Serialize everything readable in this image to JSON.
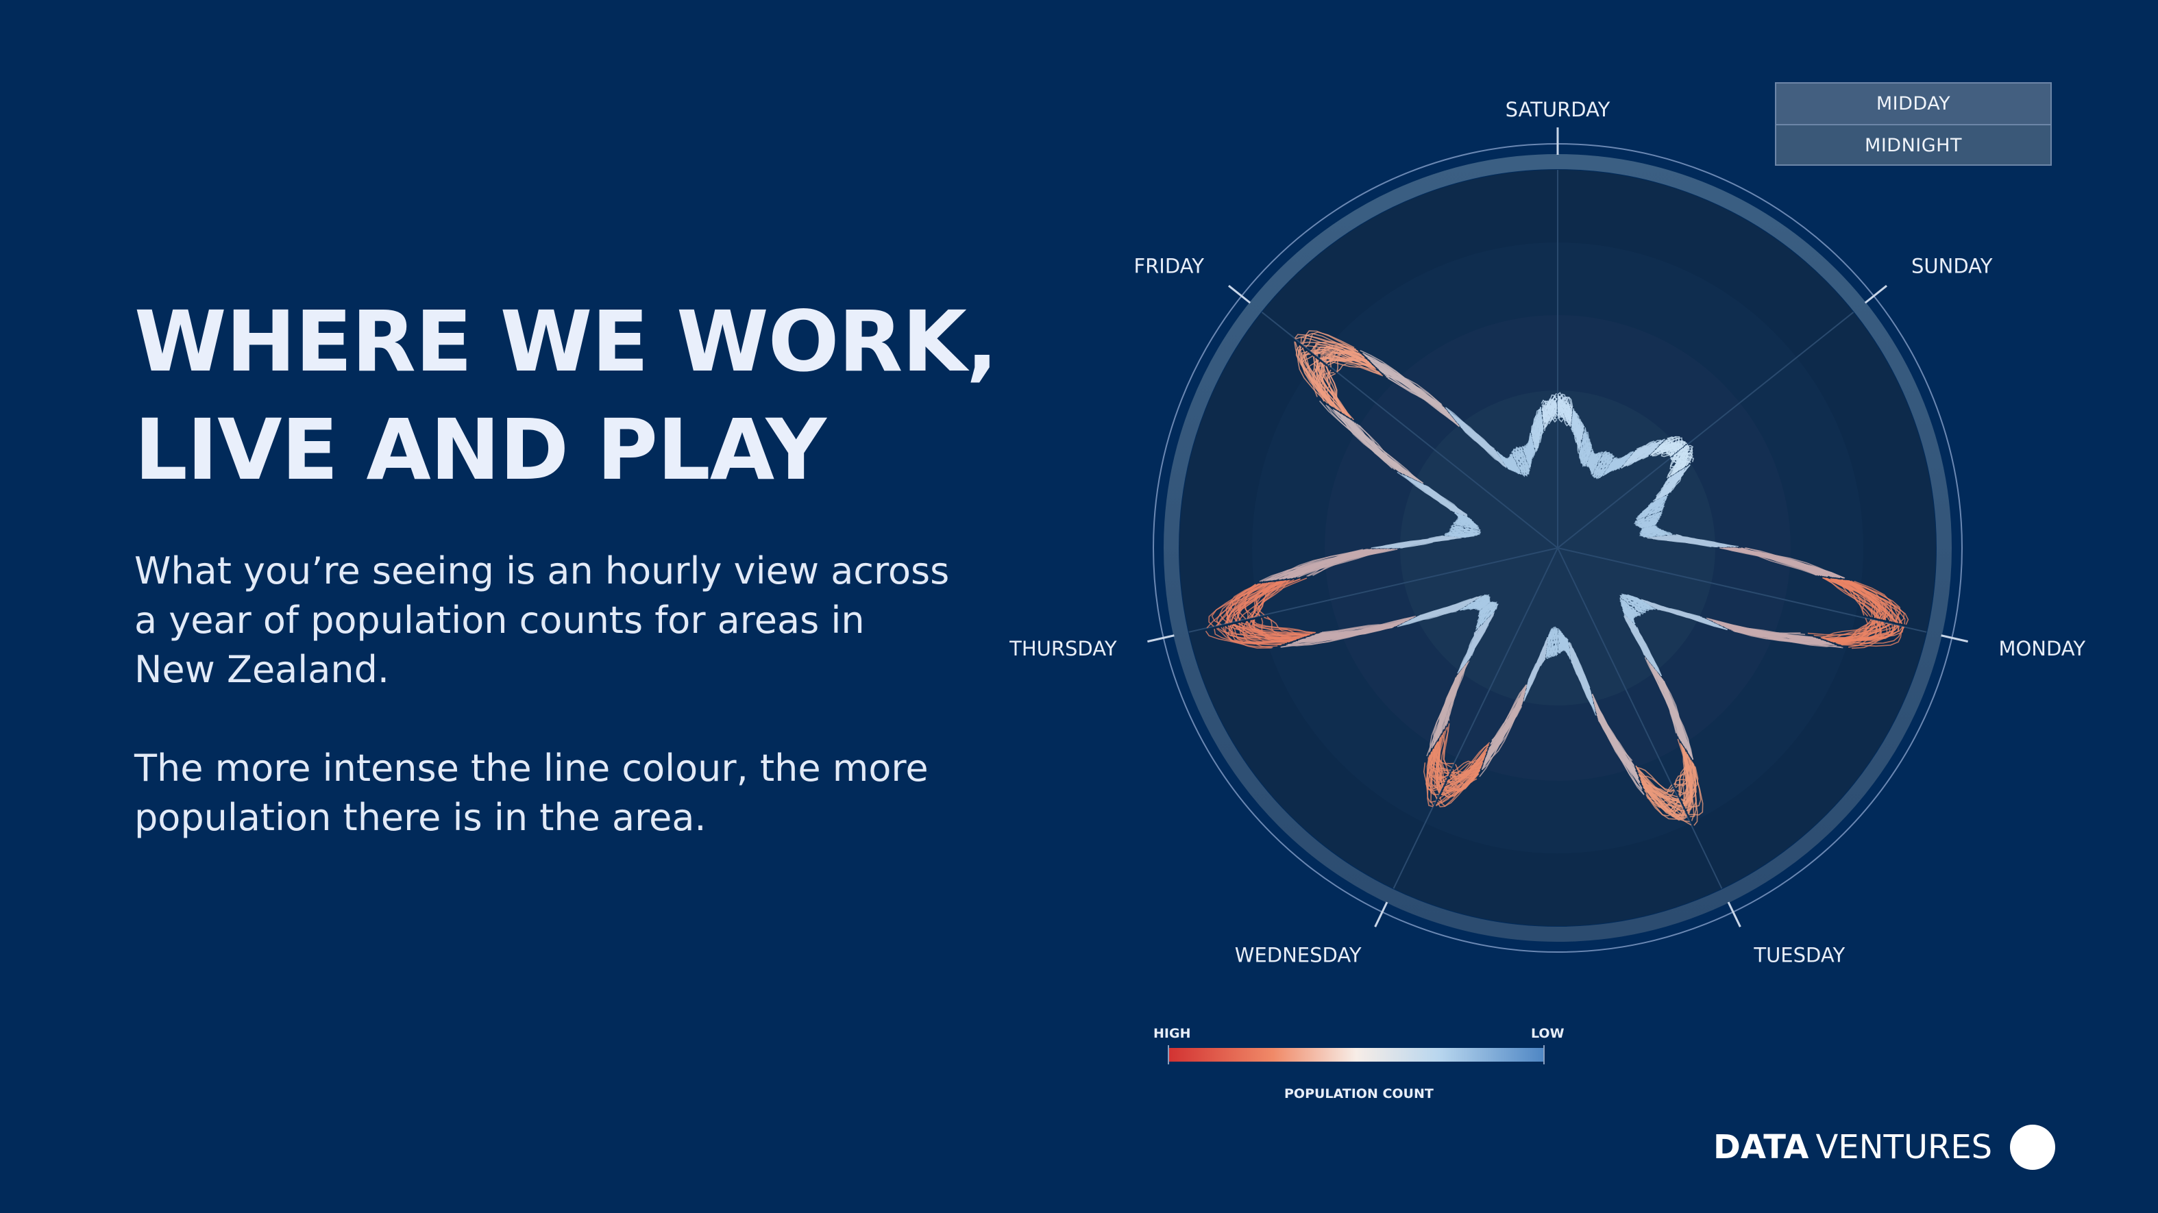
{
  "title": {
    "line1": "WHERE WE WORK,",
    "line2": "LIVE AND PLAY"
  },
  "description": {
    "paragraph1": "What you’re seeing is an hourly view across a year of population counts for areas in New Zealand.",
    "paragraph2": "The more intense the line colour, the more population there is in the area."
  },
  "toggle": {
    "options": [
      "MIDDAY",
      "MIDNIGHT"
    ],
    "selected": "MIDDAY"
  },
  "legend": {
    "high": "HIGH",
    "low": "LOW",
    "title": "POPULATION COUNT",
    "colors": [
      "#d23232",
      "#f08a68",
      "#f7ede7",
      "#b8d6ee",
      "#4e86c4"
    ]
  },
  "brand": {
    "strong": "DATA",
    "light": "VENTURES"
  },
  "chart_data": {
    "type": "radial-line",
    "axis_labels": [
      "SATURDAY",
      "SUNDAY",
      "MONDAY",
      "TUESDAY",
      "WEDNESDAY",
      "THURSDAY",
      "FRIDAY"
    ],
    "peak_values": [
      0.38,
      0.42,
      0.92,
      0.78,
      0.72,
      0.9,
      0.84
    ],
    "trough_values": [
      0.24,
      0.25,
      0.26,
      0.24,
      0.25,
      0.24,
      0.25
    ],
    "peak_colors": [
      "#c8e0f4",
      "#cfe4f5",
      "#f27d58",
      "#f29570",
      "#ef8460",
      "#f07a58",
      "#f59a78"
    ],
    "trough_color": "#a9c9e6",
    "series_count": 40
  }
}
